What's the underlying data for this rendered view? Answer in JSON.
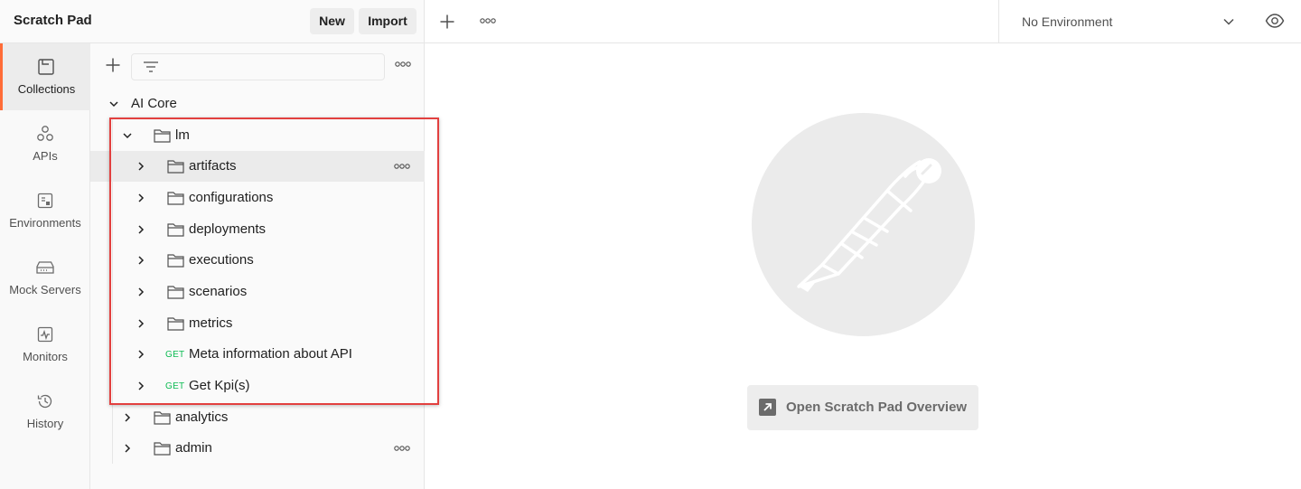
{
  "workspace": {
    "title": "Scratch Pad",
    "new_label": "New",
    "import_label": "Import"
  },
  "sidebar": {
    "items": [
      {
        "label": "Collections",
        "icon": "collections-icon",
        "active": true
      },
      {
        "label": "APIs",
        "icon": "apis-icon"
      },
      {
        "label": "Environments",
        "icon": "environments-icon"
      },
      {
        "label": "Mock Servers",
        "icon": "mock-servers-icon"
      },
      {
        "label": "Monitors",
        "icon": "monitors-icon"
      },
      {
        "label": "History",
        "icon": "history-icon"
      }
    ]
  },
  "tree": {
    "root": "AI Core",
    "lm": "lm",
    "folders": [
      "artifacts",
      "configurations",
      "deployments",
      "executions",
      "scenarios",
      "metrics"
    ],
    "requests": [
      {
        "method": "GET",
        "name": "Meta information about API"
      },
      {
        "method": "GET",
        "name": "Get Kpi(s)"
      }
    ],
    "siblings": [
      "analytics",
      "admin"
    ]
  },
  "topbar": {
    "environment": "No Environment"
  },
  "main": {
    "overview_label": "Open Scratch Pad Overview"
  },
  "colors": {
    "accent": "#ff6c37",
    "get_method": "#0cbb52",
    "highlight": "#e2403f"
  }
}
